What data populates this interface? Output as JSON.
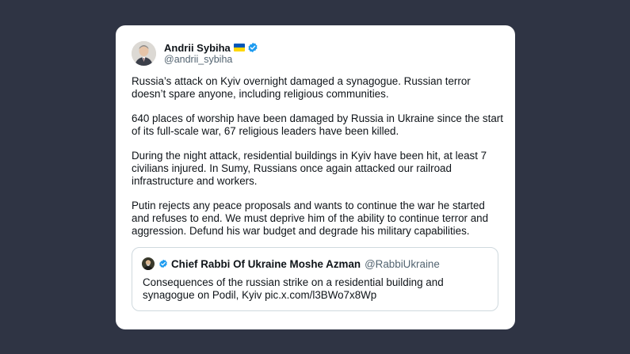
{
  "tweet": {
    "author": {
      "display_name": "Andrii Sybiha",
      "handle": "@andrii_sybiha"
    },
    "paragraphs": [
      "Russia’s attack on Kyiv overnight damaged a synagogue. Russian terror doesn’t spare anyone, including religious communities.",
      "640 places of worship have been damaged by Russia in Ukraine since the start of its full-scale war, 67 religious leaders have been killed.",
      "During the night attack, residential buildings in Kyiv have been hit, at least 7 civilians injured. In Sumy, Russians once again attacked our railroad infrastructure and workers.",
      "Putin rejects any peace proposals and wants to continue the war he started and refuses to end. We must deprive him of the ability to continue terror and aggression. Defund his war budget and degrade his military capabilities."
    ],
    "quoted": {
      "display_name": "Chief Rabbi Of Ukraine Moshe Azman",
      "handle": "@RabbiUkraine",
      "text": "Consequences of the russian strike on a residential building and synagogue on Podil, Kyiv pic.x.com/l3BWo7x8Wp"
    }
  },
  "colors": {
    "background": "#2f3444",
    "card": "#ffffff",
    "verified_badge": "#1d9bf0",
    "flag_blue": "#0057b7",
    "flag_yellow": "#ffd700",
    "secondary_text": "#536471"
  },
  "icons": {
    "author_badge": "verified-badge-icon",
    "author_flag": "ukraine-flag-icon",
    "quote_badge": "verified-badge-icon"
  }
}
